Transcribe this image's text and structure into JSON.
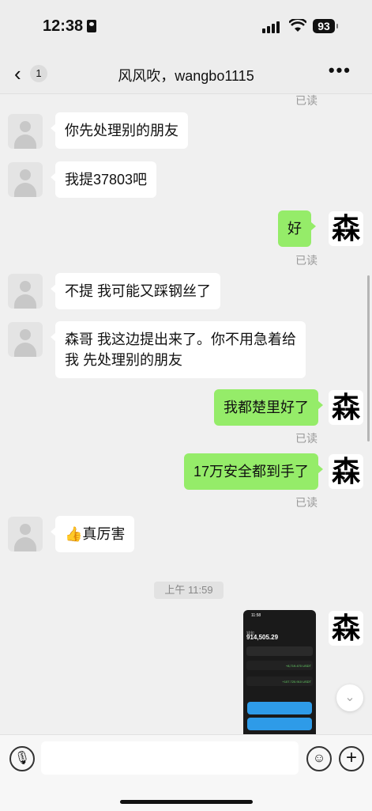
{
  "status": {
    "time": "12:38",
    "battery": "93"
  },
  "header": {
    "back_count": "1",
    "title": "风风吹，wangbo1115",
    "more": "•••"
  },
  "messages": [
    {
      "side": "in",
      "text": "你先处理别的朋友"
    },
    {
      "side": "in",
      "text": "我提37803吧"
    },
    {
      "side": "out",
      "text": "好",
      "read": "已读"
    },
    {
      "side": "in",
      "text": "不提 我可能又踩钢丝了"
    },
    {
      "side": "in",
      "text": "森哥 我这边提出来了。你不用急着给\n我 先处理别的朋友"
    },
    {
      "side": "out",
      "text": "我都楚里好了",
      "read": "已读"
    },
    {
      "side": "out",
      "text": "17万安全都到手了",
      "read": "已读"
    },
    {
      "side": "in",
      "text": "👍真厉害"
    },
    {
      "side": "out",
      "type": "image"
    }
  ],
  "top_read": "已读",
  "timestamp": "上午 11:59",
  "my_avatar_char": "森",
  "screenshot": {
    "status": "11:58",
    "header": "钱包",
    "balance": "914,505.29",
    "green_1": "+8,719.470 USDT",
    "green_2": "+107.720.910 USDT"
  },
  "input": {
    "placeholder": ""
  },
  "icons": {
    "voice": "🎙",
    "emoji": "☺",
    "plus": "+",
    "jump": "⌄"
  }
}
